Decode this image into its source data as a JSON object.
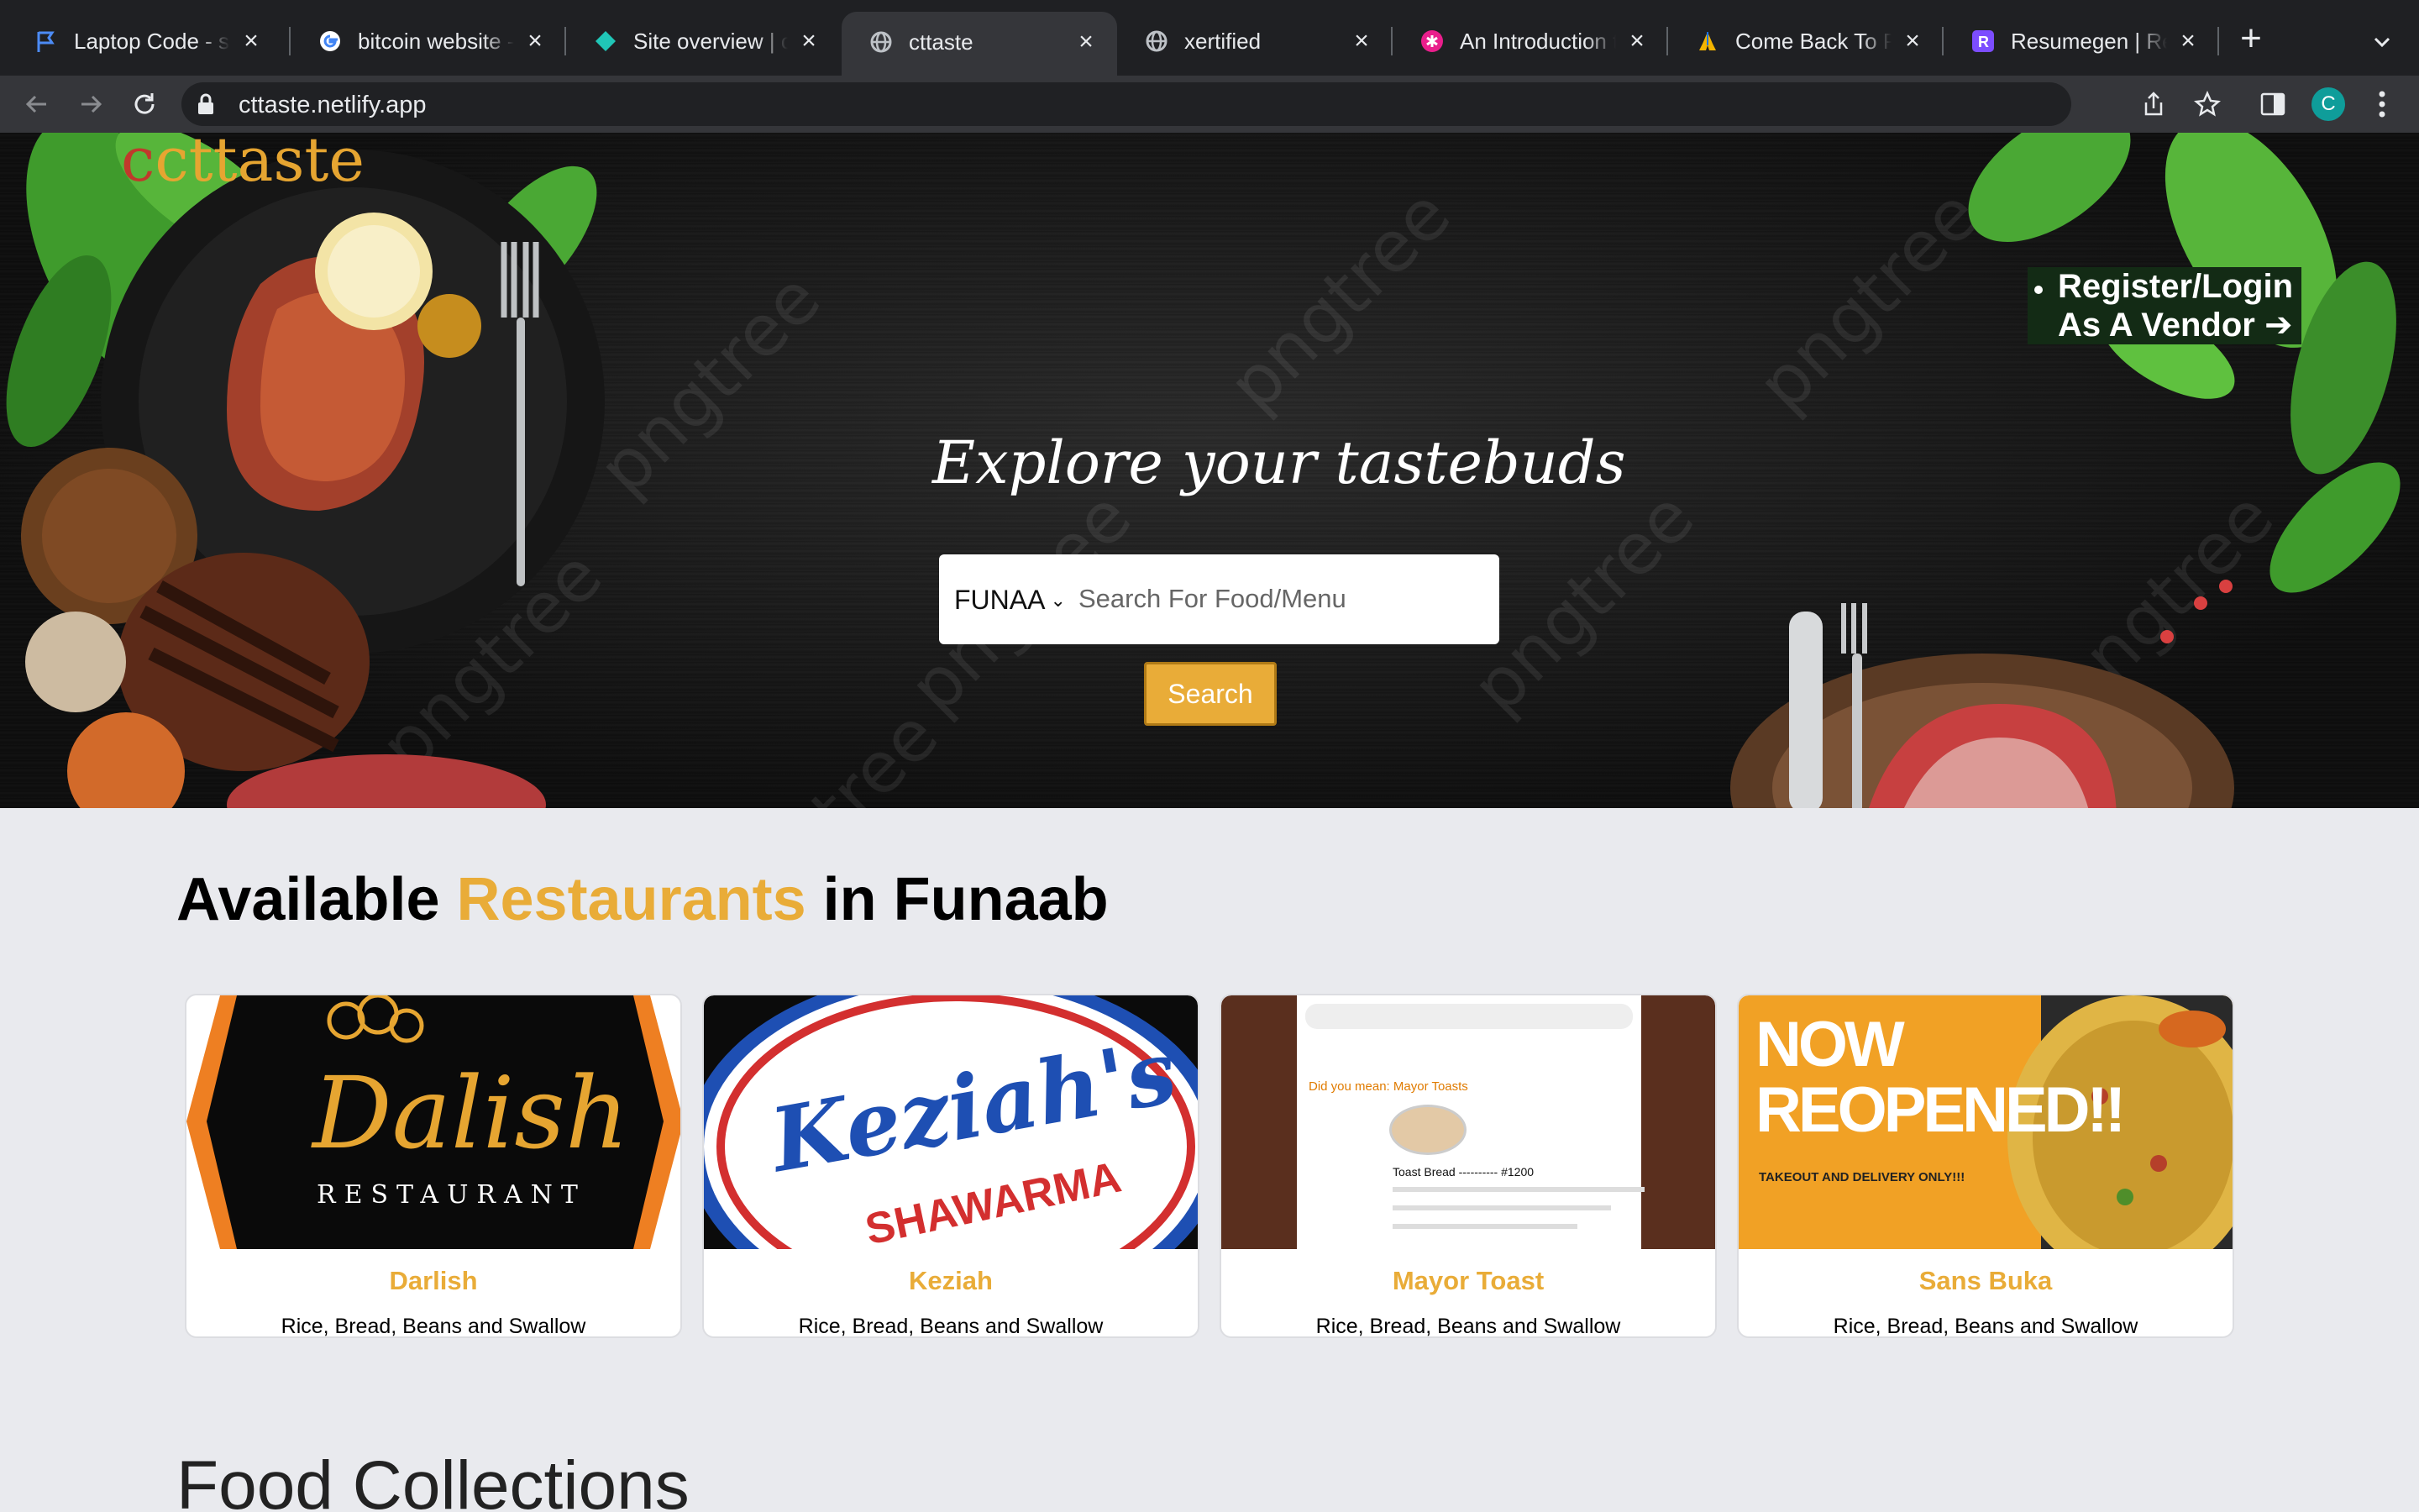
{
  "browser": {
    "tabs": [
      {
        "title": "Laptop Code - sol",
        "icon": "flag-icon"
      },
      {
        "title": "bitcoin website - G",
        "icon": "google-icon"
      },
      {
        "title": "Site overview | ctt",
        "icon": "netlify-icon"
      },
      {
        "title": "cttaste",
        "icon": "globe-icon",
        "active": true
      },
      {
        "title": "xertified",
        "icon": "globe-icon"
      },
      {
        "title": "An Introduction to",
        "icon": "asterisk-icon"
      },
      {
        "title": "Come Back To Por",
        "icon": "pray-icon"
      },
      {
        "title": "Resumegen | Resu",
        "icon": "r-logo-icon"
      }
    ],
    "url": "cttaste.netlify.app",
    "profile_initial": "C"
  },
  "hero": {
    "logo": "cttaste",
    "vendor_line1": "Register/Login",
    "vendor_line2": "As A Vendor ➔",
    "title": "Explore your tastebuds",
    "location_selected": "FUNAA",
    "search_placeholder": "Search For Food/Menu",
    "search_button": "Search",
    "watermark": "pngtree"
  },
  "restaurants": {
    "title_part1": "Available ",
    "title_highlight": "Restaurants",
    "title_part2": " in Funaab",
    "items": [
      {
        "name": "Darlish",
        "description": "Rice, Bread, Beans and Swallow",
        "logo_text": "Dalish",
        "logo_sub": "RESTAURANT"
      },
      {
        "name": "Keziah",
        "description": "Rice, Bread, Beans and Swallow",
        "logo_text": "Keziah's",
        "logo_sub": "SHAWARMA"
      },
      {
        "name": "Mayor Toast",
        "description": "Rice, Bread, Beans and Swallow",
        "logo_text": "Did you mean: Mayor Toasts",
        "logo_sub": "Toast Bread ---------- #1200"
      },
      {
        "name": "Sans Buka",
        "description": "Rice, Bread, Beans and Swallow",
        "logo_text": "NOW REOPENED!!",
        "logo_sub": "TAKEOUT AND DELIVERY ONLY!!!"
      }
    ]
  },
  "collections": {
    "title": "Food Collections"
  },
  "colors": {
    "accent": "#e9ac38",
    "vendor_bg": "#132b15",
    "page_bg": "#e9eaee"
  }
}
